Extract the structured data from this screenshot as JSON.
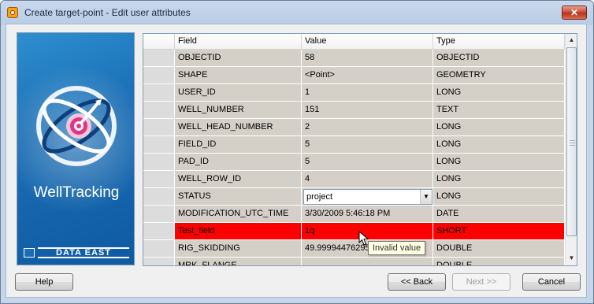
{
  "window": {
    "title": "Create target-point - Edit user attributes",
    "close_label": "✕"
  },
  "banner": {
    "brand": "WellTracking",
    "vendor": "DATA EAST"
  },
  "grid": {
    "columns": [
      "Field",
      "Value",
      "Type"
    ],
    "rows": [
      {
        "field": "OBJECTID",
        "value": "58",
        "type": "OBJECTID"
      },
      {
        "field": "SHAPE",
        "value": "<Point>",
        "type": "GEOMETRY"
      },
      {
        "field": "USER_ID",
        "value": "1",
        "type": "LONG"
      },
      {
        "field": "WELL_NUMBER",
        "value": "151",
        "type": "TEXT"
      },
      {
        "field": "WELL_HEAD_NUMBER",
        "value": "2",
        "type": "LONG"
      },
      {
        "field": "FIELD_ID",
        "value": "5",
        "type": "LONG"
      },
      {
        "field": "PAD_ID",
        "value": "5",
        "type": "LONG"
      },
      {
        "field": "WELL_ROW_ID",
        "value": "4",
        "type": "LONG"
      },
      {
        "field": "STATUS",
        "value": "project",
        "type": "LONG"
      },
      {
        "field": "MODIFICATION_UTC_TIME",
        "value": "3/30/2009 5:46:18 PM",
        "type": "DATE"
      },
      {
        "field": "Test_field",
        "value": "1q",
        "type": "SHORT"
      },
      {
        "field": "RIG_SKIDDING",
        "value": "49.99994476295",
        "type": "DOUBLE"
      },
      {
        "field": "MRK_FLANGE",
        "value": "",
        "type": "DOUBLE"
      }
    ]
  },
  "tooltip": "Invalid value",
  "colors": {
    "invalid_row": "#ff0000",
    "row_bg": "#d4d0c8"
  },
  "buttons": {
    "help": "Help",
    "back": "<< Back",
    "next": "Next >>",
    "cancel": "Cancel"
  }
}
